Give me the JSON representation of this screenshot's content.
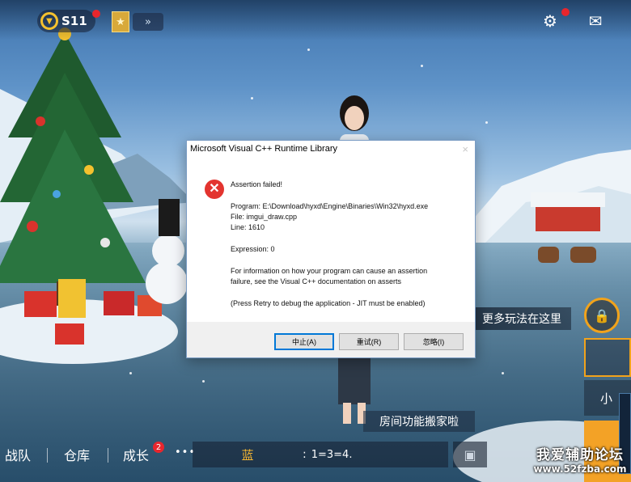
{
  "game": {
    "season_label": "S11",
    "rank_glyph": "★",
    "expand_glyph": "»",
    "more_play_label": "更多玩法在这里",
    "side_label": "小",
    "moved_tip": "房间功能搬家啦",
    "tabs": [
      "战队",
      "仓库",
      "成长"
    ],
    "growth_badge": "2",
    "more_dots": "•••",
    "chat_channel": "蓝",
    "chat_sep": ":",
    "chat_message": "1=3=4.",
    "colors": {
      "accent": "#f2a31b",
      "alert": "#e8262d",
      "channel": "#f5b531"
    }
  },
  "dialog": {
    "title": "Microsoft Visual C++ Runtime Library",
    "close_glyph": "×",
    "error_glyph": "✕",
    "headline": "Assertion failed!",
    "program_line": "Program: E:\\Download\\hyxd\\Engine\\Binaries\\Win32\\hyxd.exe",
    "file_line": "File: imgui_draw.cpp",
    "line_line": "Line: 1610",
    "expression_line": "Expression: 0",
    "info_line1": "For information on how your program can cause an assertion",
    "info_line2": "failure, see the Visual C++ documentation on asserts",
    "retry_hint": "(Press Retry to debug the application - JIT must be enabled)",
    "buttons": {
      "abort": "中止(A)",
      "retry": "重试(R)",
      "ignore": "忽略(I)"
    }
  },
  "watermark": {
    "line1": "我爱辅助论坛",
    "line2": "www.52fzba.com"
  }
}
